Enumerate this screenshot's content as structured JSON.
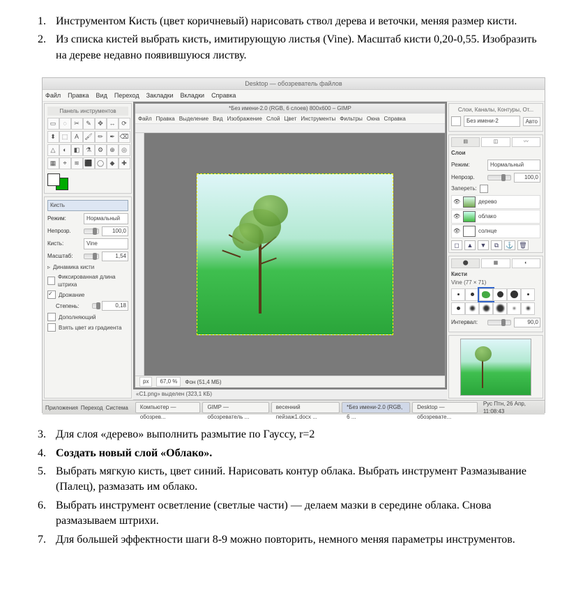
{
  "list_top": [
    "Инструментом Кисть (цвет коричневый) нарисовать ствол дерева и веточки, меняя размер кисти.",
    "Из списка кистей выбрать кисть, имитирующую листья (Vine). Масштаб кисти 0,20-0,55. Изобразить на дереве недавно появившуюся листву."
  ],
  "list_bottom": [
    "Для слоя «дерево» выполнить размытие по Гауссу, r=2",
    "Создать новый слой «Облако».",
    "Выбрать мягкую кисть, цвет синий. Нарисовать контур облака. Выбрать инструмент Размазывание (Палец), размазать им облако.",
    "Выбрать инструмент осветление (светлые части) — делаем мазки в середине облака. Снова размазываем штрихи.",
    "Для большей эффектности шаги 8-9 можно повторить, немного меняя параметры инструментов."
  ],
  "list_bottom_start": 3,
  "bold_index": 1,
  "desktop_title": "Desktop — обозреватель файлов",
  "os_menu": [
    "Файл",
    "Правка",
    "Вид",
    "Переход",
    "Закладки",
    "Вкладки",
    "Справка"
  ],
  "toolbox_title": "Панель инструментов",
  "tool_opts": {
    "section": "Кисть",
    "mode_label": "Режим:",
    "mode_value": "Нормальный",
    "opacity_label": "Непрозр.",
    "opacity_value": "100,0",
    "brush_label": "Кисть:",
    "brush_value": "Vine",
    "scale_label": "Масштаб:",
    "scale_value": "1,54",
    "dynamics": "Динамика кисти",
    "fixed_len": "Фиксированная длина штриха",
    "jitter": "Дрожание",
    "jitter_step_label": "Степень:",
    "jitter_step_value": "0,18",
    "incremental": "Дополняющий",
    "from_gradient": "Взять цвет из градиента"
  },
  "doc": {
    "title": "*Без имени-2.0 (RGB, 6 слоев) 800x600 – GIMP",
    "menu": [
      "Файл",
      "Правка",
      "Выделение",
      "Вид",
      "Изображение",
      "Слой",
      "Цвет",
      "Инструменты",
      "Фильтры",
      "Окна",
      "Справка"
    ],
    "zoom_unit": "px",
    "zoom_pct": "67,0 %",
    "status": "Фон (51,4 МБ)"
  },
  "selection_status": "«C1.png» выделен (323,1 КБ)",
  "layers": {
    "title": "Слои",
    "mode_label": "Режим:",
    "mode_value": "Нормальный",
    "opacity_label": "Непрозр.",
    "opacity_value": "100,0",
    "lock_label": "Запереть:",
    "doc_tab": "Без имени-2",
    "auto": "Авто",
    "items": [
      {
        "name": "дерево"
      },
      {
        "name": "облако"
      },
      {
        "name": "солнце"
      }
    ]
  },
  "brushes": {
    "title": "Кисти",
    "current": "Vine (77 × 71)",
    "interval_label": "Интервал:",
    "interval_value": "90,0"
  },
  "taskbar": {
    "apps_label": "Приложения",
    "places_label": "Переход",
    "system_label": "Система",
    "items": [
      "Компьютер — обозрев...",
      "GIMP — обозреватель ...",
      "весенний пейзаж1.docx ...",
      "*Без имени-2.0 (RGB, 6 ...",
      "Desktop — обозревате..."
    ],
    "clock": "Рус  Птн, 26 Апр, 11:08:43"
  },
  "panels_right_title": "Слои, Каналы, Контуры, От..."
}
